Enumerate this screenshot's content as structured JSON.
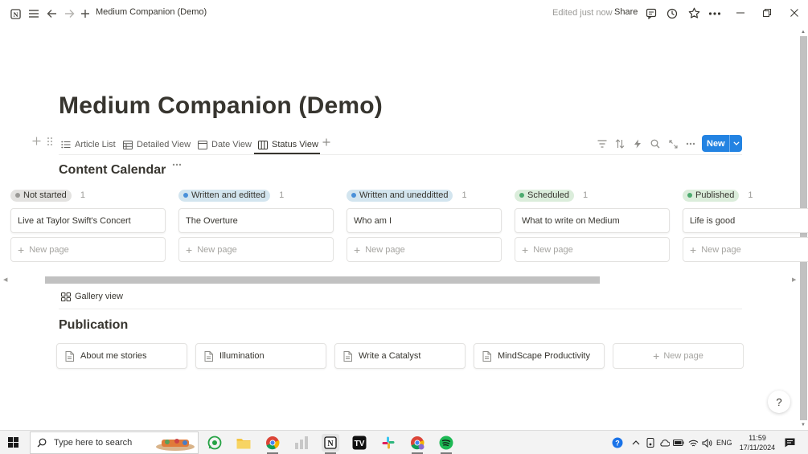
{
  "topbar": {
    "page_name": "Medium Companion (Demo)",
    "edited_status": "Edited just now",
    "share_label": "Share"
  },
  "page": {
    "title": "Medium Companion (Demo)"
  },
  "views": {
    "tabs": [
      {
        "label": "Article List",
        "icon": "list-icon"
      },
      {
        "label": "Detailed View",
        "icon": "table-icon"
      },
      {
        "label": "Date View",
        "icon": "calendar-icon"
      },
      {
        "label": "Status View",
        "icon": "board-icon",
        "active": true
      }
    ],
    "new_button_label": "New"
  },
  "content_calendar": {
    "title": "Content Calendar",
    "columns": [
      {
        "status": "Not started",
        "count": "1",
        "color": "#9b9a97",
        "bg": "#e3e2e0",
        "card": "Live at Taylor Swift's Concert",
        "new_page": "New page"
      },
      {
        "status": "Written and editted",
        "count": "1",
        "color": "#4a90d9",
        "bg": "#d3e5ef",
        "card": "The Overture",
        "new_page": "New page"
      },
      {
        "status": "Written and unedditted",
        "count": "1",
        "color": "#4a90d9",
        "bg": "#d3e5ef",
        "card": "Who am I",
        "new_page": "New page"
      },
      {
        "status": "Scheduled",
        "count": "1",
        "color": "#4dab6f",
        "bg": "#dbeddb",
        "card": "What to write on Medium",
        "new_page": "New page"
      },
      {
        "status": "Published",
        "count": "1",
        "color": "#4dab6f",
        "bg": "#dbeddb",
        "card": "Life is good",
        "new_page": "New page"
      }
    ]
  },
  "gallery": {
    "tab_label": "Gallery view",
    "title": "Publication",
    "cards": [
      "About me stories",
      "Illumination",
      "Write a Catalyst",
      "MindScape Productivity"
    ],
    "new_page": "New page"
  },
  "help": {
    "glyph": "?"
  },
  "taskbar": {
    "search_placeholder": "Type here to search",
    "language": "ENG",
    "time": "11:59",
    "date": "17/11/2024"
  }
}
